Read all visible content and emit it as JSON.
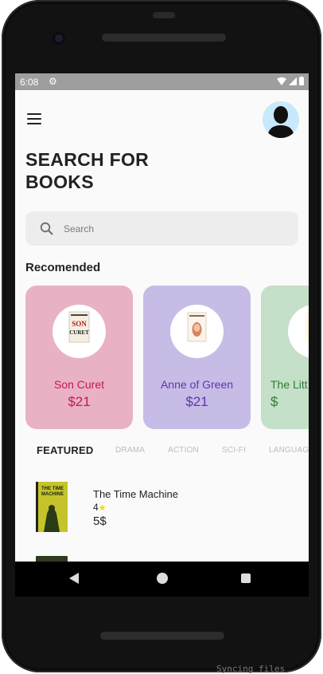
{
  "status_bar": {
    "time": "6:08"
  },
  "header": {
    "title": "SEARCH FOR\nBOOKS"
  },
  "search": {
    "placeholder": "Search"
  },
  "recommended": {
    "title": "Recomended",
    "cards": [
      {
        "title": "Son Curet",
        "price": "$21",
        "color": "#e8b2c4",
        "cover_text": "SON CURET"
      },
      {
        "title": "Anne of Green",
        "price": "$21",
        "color": "#c7bce5"
      },
      {
        "title": "The Litt",
        "price": "$",
        "color": "#c4e0c8"
      }
    ]
  },
  "tabs": [
    "FEATURED",
    "DRAMA",
    "ACTION",
    "SCI-FI",
    "LANGUAGE"
  ],
  "featured": [
    {
      "title": "The Time Machine",
      "rating": "4",
      "price": "5$",
      "cover_text": "THE TIME MACHINE"
    }
  ],
  "icons": {
    "menu": "menu-icon",
    "search": "search-icon",
    "star": "star-icon",
    "back": "back-icon",
    "home": "home-icon",
    "recent": "recent-apps-icon"
  },
  "watermark": "Syncing files"
}
